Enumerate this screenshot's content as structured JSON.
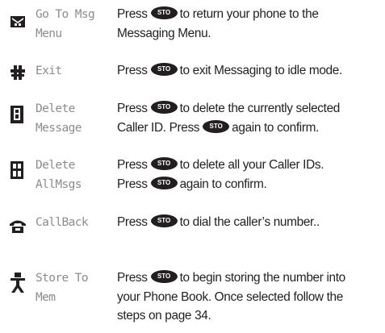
{
  "key_label": "STO",
  "rows": [
    {
      "icon": "envelope-return-icon",
      "label1": "Go To Msg",
      "label2": "Menu",
      "d1a": "Press",
      "d1b": "to return your phone to the",
      "d2": "Messaging Menu."
    },
    {
      "icon": "exit-icon",
      "label1": "Exit",
      "d1a": "Press",
      "d1b": "to exit Messaging to idle mode."
    },
    {
      "icon": "trash-single-icon",
      "label1": "Delete",
      "label2": "Message",
      "d1a": "Press",
      "d1b": "to delete the currently selected",
      "d2a": "Caller ID. Press",
      "d2b": "again to confirm."
    },
    {
      "icon": "trash-all-icon",
      "label1": "Delete",
      "label2": "AllMsgs",
      "d1a": "Press",
      "d1b": "to delete all your Caller IDs.",
      "d2a": "Press",
      "d2b": "again to confirm."
    },
    {
      "icon": "phone-callback-icon",
      "label1": "CallBack",
      "d1a": "Press",
      "d1b": "to dial the caller’s number.."
    },
    {
      "icon": "store-to-memory-icon",
      "label1": "Store To",
      "label2": "Mem",
      "d1a": "Press",
      "d1b": "to begin storing the number into",
      "d2": "your Phone Book. Once selected follow the",
      "d3": "steps on page 34."
    }
  ]
}
